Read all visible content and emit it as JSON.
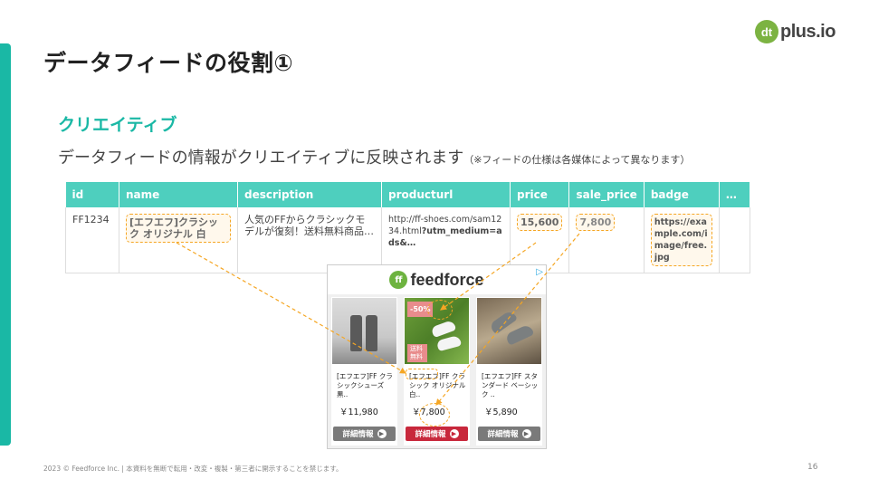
{
  "logo": {
    "mark": "dt",
    "text": "plus.io"
  },
  "slide_title": "データフィードの役割①",
  "section_title": "クリエイティブ",
  "lead": {
    "main": "データフィードの情報がクリエイティブに反映されます",
    "note": "（※フィードの仕様は各媒体によって異なります）"
  },
  "table": {
    "headers": [
      "id",
      "name",
      "description",
      "producturl",
      "price",
      "sale_price",
      "badge",
      "…"
    ],
    "row": {
      "id": "FF1234",
      "name": "[エフエフ]クラシック オリジナル 白",
      "description": "人気のFFからクラシックモデルが復刻！送料無料商品…",
      "producturl_plain": "http://ff-shoes.com/sam1234.html",
      "producturl_bold": "?utm_medium=ads&…",
      "price": "15,600",
      "sale_price": "7,800",
      "badge": "https://example.com/image/free.jpg",
      "more": ""
    }
  },
  "ad": {
    "brand_mark": "ff",
    "brand_text": "feedforce",
    "adchoice_icon": "adchoices-icon",
    "cards": [
      {
        "name": "[エフエフ]FF クラシックシューズ 黒..",
        "price": "￥11,980",
        "button": "詳細情報",
        "badge_pct": "",
        "badge_free": ""
      },
      {
        "name": "[エフエフ]FF クラシック オリジナル 白..",
        "price": "￥7,800",
        "button": "詳細情報",
        "badge_pct": "-50%",
        "badge_free": "送料無料"
      },
      {
        "name": "[エフエフ]FF スタンダード ベーシック ..",
        "price": "￥5,890",
        "button": "詳細情報",
        "badge_pct": "",
        "badge_free": ""
      }
    ]
  },
  "colors": {
    "accent": "#1ab8a5",
    "header": "#4ecfbe",
    "highlight": "#f5a623",
    "cta_red": "#c8283c"
  },
  "footer": "2023 © Feedforce Inc. | 本資料を無断で転用・改変・複製・第三者に開示することを禁じます。",
  "page_number": "16"
}
